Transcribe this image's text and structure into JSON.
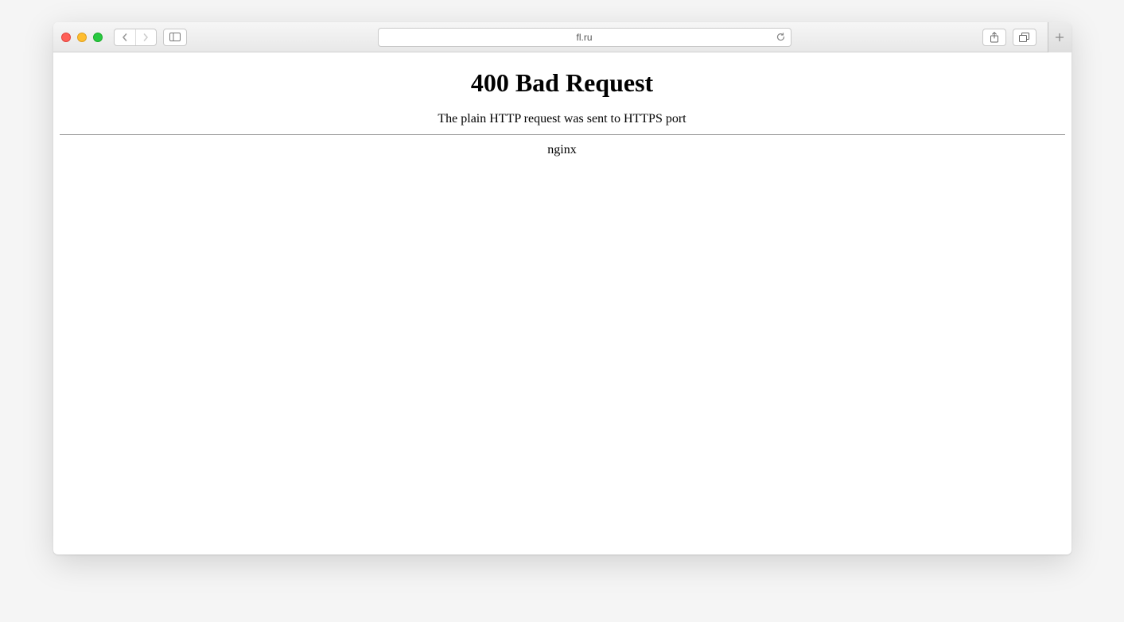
{
  "address_bar": {
    "url": "fl.ru"
  },
  "page": {
    "heading": "400 Bad Request",
    "message": "The plain HTTP request was sent to HTTPS port",
    "server": "nginx"
  }
}
